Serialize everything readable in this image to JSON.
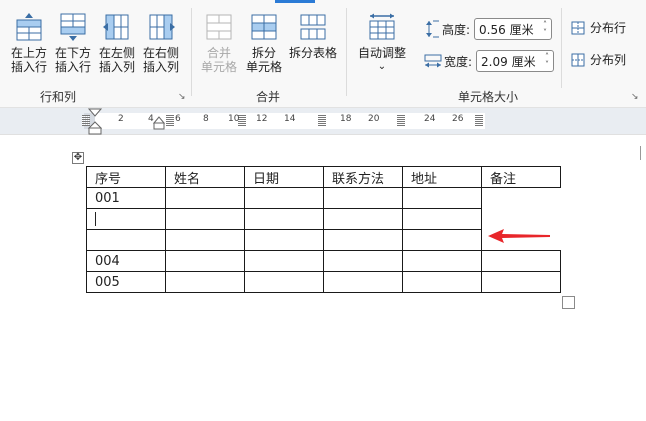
{
  "ribbon": {
    "rows_cols": {
      "label": "行和列",
      "buttons": [
        {
          "line1": "在上方",
          "line2": "插入行"
        },
        {
          "line1": "在下方",
          "line2": "插入行"
        },
        {
          "line1": "在左侧",
          "line2": "插入列"
        },
        {
          "line1": "在右侧",
          "line2": "插入列"
        }
      ]
    },
    "merge": {
      "label": "合并",
      "merge_cells": {
        "line1": "合并",
        "line2": "单元格"
      },
      "split_cells": {
        "line1": "拆分",
        "line2": "单元格"
      },
      "split_table": {
        "line1": "拆分表格"
      }
    },
    "cell_size": {
      "label": "单元格大小",
      "autofit": {
        "line1": "自动调整",
        "line2": "⌄"
      },
      "height_label": "高度:",
      "height_value": "0.56 厘米",
      "width_label": "宽度:",
      "width_value": "2.09 厘米",
      "distribute_rows": "分布行",
      "distribute_cols": "分布列"
    }
  },
  "ruler": {
    "ticks": [
      "2",
      "4",
      "6",
      "8",
      "10",
      "12",
      "14",
      "16",
      "18",
      "20",
      "22",
      "24",
      "26"
    ]
  },
  "table": {
    "headers": [
      "序号",
      "姓名",
      "日期",
      "联系方法",
      "地址",
      "备注"
    ],
    "rows": [
      [
        "001",
        "",
        "",
        "",
        "",
        ""
      ],
      [
        "",
        "",
        "",
        "",
        ""
      ],
      [
        "",
        "",
        "",
        "",
        ""
      ],
      [
        "004",
        "",
        "",
        "",
        "",
        ""
      ],
      [
        "005",
        "",
        "",
        "",
        "",
        ""
      ]
    ]
  },
  "colors": {
    "accent_blue": "#2b7bd6",
    "arrow_red": "#e8262a"
  }
}
